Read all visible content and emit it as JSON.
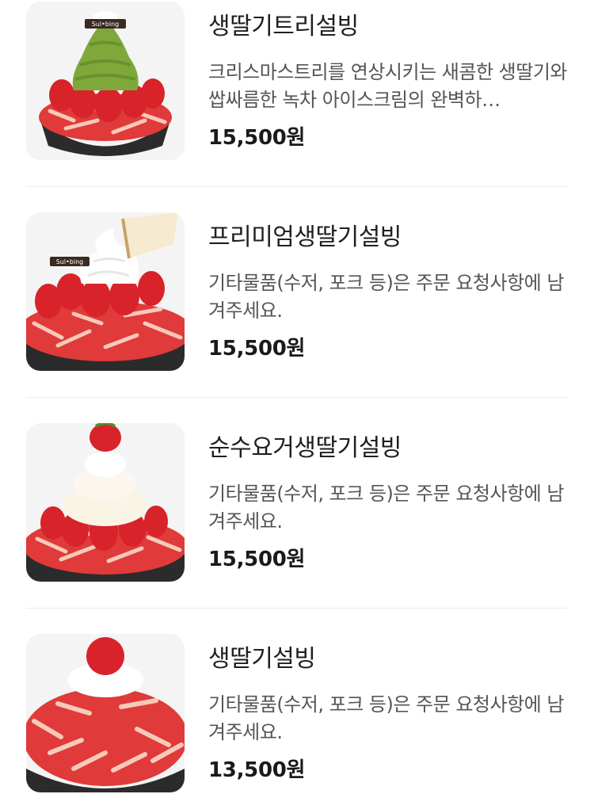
{
  "menu": {
    "items": [
      {
        "name": "생딸기트리설빙",
        "description": "크리스마스트리를 연상시키는 새콤한 생딸기와 쌉싸름한 녹차 아이스크림의 완벽하…",
        "price": "15,500원",
        "image_icon": "strawberry-matcha-bingsu-photo",
        "logo_text": "Sul•bing"
      },
      {
        "name": "프리미엄생딸기설빙",
        "description": "기타물품(수저, 포크 등)은 주문 요청사항에 남겨주세요.",
        "price": "15,500원",
        "image_icon": "premium-strawberry-bingsu-photo",
        "logo_text": "Sul•bing"
      },
      {
        "name": "순수요거생딸기설빙",
        "description": "기타물품(수저, 포크 등)은 주문 요청사항에 남겨주세요.",
        "price": "15,500원",
        "image_icon": "yogurt-strawberry-bingsu-photo"
      },
      {
        "name": "생딸기설빙",
        "description": "기타물품(수저, 포크 등)은 주문 요청사항에 남겨주세요.",
        "price": "13,500원",
        "image_icon": "strawberry-bingsu-photo"
      }
    ]
  },
  "colors": {
    "strawberry": "#d8232a",
    "matcha": "#7ea83a",
    "cream": "#fbf7ee",
    "bowl": "#2b2b2b",
    "text_primary": "#1f1f1f",
    "text_secondary": "#555555",
    "divider": "#ececec"
  }
}
